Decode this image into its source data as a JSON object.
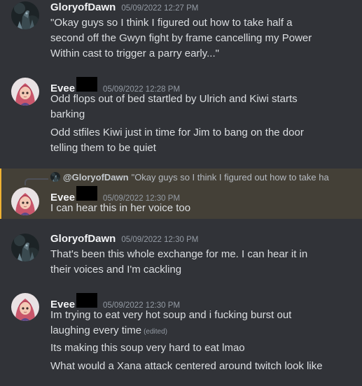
{
  "messages": [
    {
      "username": "GloryofDawn",
      "timestamp": "05/09/2022 12:27 PM",
      "avatar_icon": "dark-knight-avatar-icon",
      "lines": [
        "\"Okay guys so I think I figured out how to take half a",
        "second off the Gwyn fight by frame cancelling my Power",
        "Within cast to trigger a parry early...\""
      ]
    },
    {
      "username": "Evee",
      "timestamp": "05/09/2022 12:28 PM",
      "avatar_icon": "pink-hair-girl-avatar-icon",
      "lines": [
        "Odd flops out of bed startled by Ulrich and Kiwi starts",
        "barking"
      ],
      "lines2": [
        "Odd stfiles Kiwi just in time for Jim to bang on the door",
        "telling them to be quiet"
      ]
    },
    {
      "username": "Evee",
      "timestamp": "05/09/2022 12:30 PM",
      "avatar_icon": "pink-hair-girl-avatar-icon",
      "reply": {
        "user": "@GloryofDawn",
        "text": "\"Okay guys so I think I figured out how to take ha"
      },
      "lines": [
        "I can hear this in her voice too"
      ]
    },
    {
      "username": "GloryofDawn",
      "timestamp": "05/09/2022 12:30 PM",
      "avatar_icon": "dark-knight-avatar-icon",
      "lines": [
        "That's been this whole exchange for me. I can hear it in",
        "their voices and I'm cackling"
      ]
    },
    {
      "username": "Evee",
      "timestamp": "05/09/2022 12:30 PM",
      "avatar_icon": "pink-hair-girl-avatar-icon",
      "lines": [
        "Im trying to eat very hot soup and i fucking burst out",
        "laughing every time"
      ],
      "edited": "(edited)",
      "lines2": [
        "Its making this soup very hard to eat lmao"
      ],
      "lines3": [
        "What would a Xana attack centered around twitch look like"
      ]
    }
  ],
  "colors": {
    "background": "#313338",
    "highlight": "#444037",
    "highlight_bar": "#f0b232",
    "username": "#f2f3f5",
    "text": "#dbdee1",
    "timestamp": "#949ba4"
  }
}
